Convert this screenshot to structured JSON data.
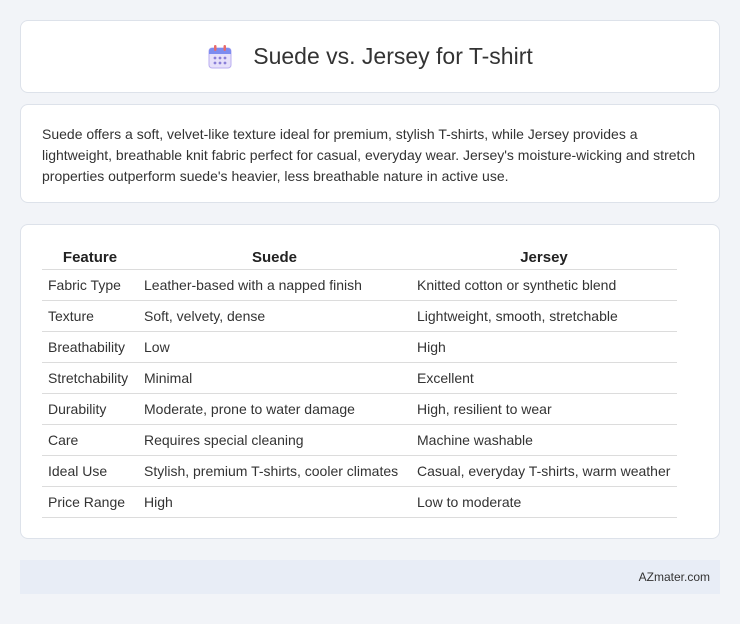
{
  "header": {
    "title": "Suede vs. Jersey for T-shirt",
    "icon": "calendar-icon"
  },
  "summary": {
    "text": "Suede offers a soft, velvet-like texture ideal for premium, stylish T-shirts, while Jersey provides a lightweight, breathable knit fabric perfect for casual, everyday wear. Jersey's moisture-wicking and stretch properties outperform suede's heavier, less breathable nature in active use."
  },
  "table": {
    "columns": [
      "Feature",
      "Suede",
      "Jersey"
    ],
    "rows": [
      [
        "Fabric Type",
        "Leather-based with a napped finish",
        "Knitted cotton or synthetic blend"
      ],
      [
        "Texture",
        "Soft, velvety, dense",
        "Lightweight, smooth, stretchable"
      ],
      [
        "Breathability",
        "Low",
        "High"
      ],
      [
        "Stretchability",
        "Minimal",
        "Excellent"
      ],
      [
        "Durability",
        "Moderate, prone to water damage",
        "High, resilient to wear"
      ],
      [
        "Care",
        "Requires special cleaning",
        "Machine washable"
      ],
      [
        "Ideal Use",
        "Stylish, premium T-shirts, cooler climates",
        "Casual, everyday T-shirts, warm weather"
      ],
      [
        "Price Range",
        "High",
        "Low to moderate"
      ]
    ]
  },
  "footer": {
    "text": "AZmater.com"
  }
}
